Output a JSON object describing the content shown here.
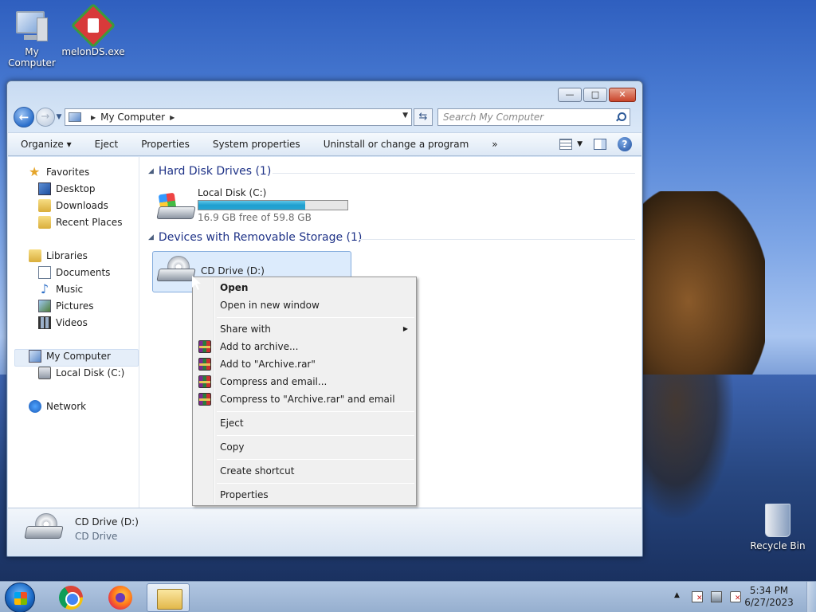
{
  "desktop": {
    "icons": [
      {
        "label": "My Computer"
      },
      {
        "label": "melonDS.exe"
      }
    ],
    "recycle_bin": "Recycle Bin"
  },
  "window": {
    "caption_buttons": {
      "minimize": "—",
      "maximize": "□",
      "close": "✕"
    },
    "address": {
      "segment": "My Computer"
    },
    "search": {
      "placeholder": "Search My Computer"
    },
    "toolbar": {
      "organize": "Organize",
      "eject": "Eject",
      "properties": "Properties",
      "system_properties": "System properties",
      "uninstall": "Uninstall or change a program",
      "overflow": "»",
      "help": "?"
    },
    "nav_pane": {
      "favorites": "Favorites",
      "desktop": "Desktop",
      "downloads": "Downloads",
      "recent_places": "Recent Places",
      "libraries": "Libraries",
      "documents": "Documents",
      "music": "Music",
      "pictures": "Pictures",
      "videos": "Videos",
      "my_computer": "My Computer",
      "local_disk": "Local Disk (C:)",
      "network": "Network"
    },
    "groups": {
      "hard_disk": "Hard Disk Drives (1)",
      "removable": "Devices with Removable Storage (1)"
    },
    "drives": {
      "c": {
        "name": "Local Disk (C:)",
        "free_text": "16.9 GB free of 59.8 GB",
        "used_fraction": 0.717
      },
      "d": {
        "name": "CD Drive (D:)"
      }
    },
    "details": {
      "name": "CD Drive (D:)",
      "type": "CD Drive"
    }
  },
  "context_menu": {
    "open": "Open",
    "open_new_window": "Open in new window",
    "share_with": "Share with",
    "add_to_archive": "Add to archive...",
    "add_to_archive_rar": "Add to \"Archive.rar\"",
    "compress_email": "Compress and email...",
    "compress_rar_email": "Compress to \"Archive.rar\" and email",
    "eject": "Eject",
    "copy": "Copy",
    "create_shortcut": "Create shortcut",
    "properties": "Properties"
  },
  "taskbar": {
    "time": "5:34 PM",
    "date": "6/27/2023"
  },
  "icons": {
    "computer": "computer-icon",
    "melonds": "melonds-icon",
    "recycle": "recycle-bin-icon",
    "rar": "winrar-icon"
  },
  "colors": {
    "usage_bar": "#26a4d3",
    "group_header": "#1e3287",
    "selection": "#dcebfc"
  }
}
